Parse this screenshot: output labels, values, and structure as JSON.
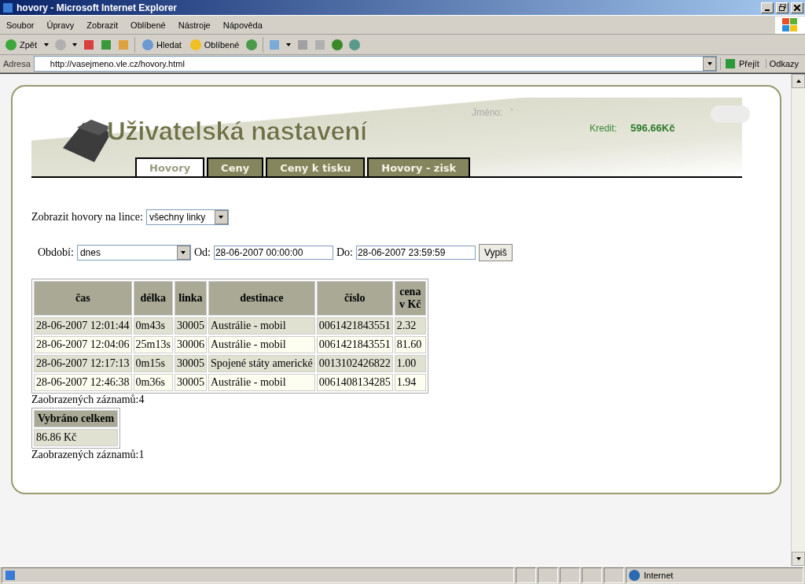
{
  "window": {
    "title": "hovory - Microsoft Internet Explorer"
  },
  "menu": [
    "Soubor",
    "Úpravy",
    "Zobrazit",
    "Oblíbené",
    "Nástroje",
    "Nápověda"
  ],
  "toolbar": {
    "back": "Zpět",
    "search": "Hledat",
    "favorites": "Oblíbené"
  },
  "address": {
    "label": "Adresa",
    "value": "http://vasejmeno.vle.cz/hovory.html",
    "go": "Přejít",
    "links": "Odkazy"
  },
  "header": {
    "title": "Uživatelská nastavení",
    "name_label": "Jméno:",
    "name_value": "'",
    "credit_label": "Kredit:",
    "credit_value": "596.66Kč"
  },
  "tabs": [
    {
      "label": "Hovory",
      "selected": true
    },
    {
      "label": "Ceny",
      "selected": false
    },
    {
      "label": "Ceny k tisku",
      "selected": false
    },
    {
      "label": "Hovory - zisk",
      "selected": false
    }
  ],
  "line_filter": {
    "label": "Zobrazit hovory na lince:",
    "value": "všechny linky"
  },
  "period": {
    "label": "Období:",
    "value": "dnes",
    "from_label": "Od:",
    "from_value": "28-06-2007 00:00:00",
    "to_label": "Do:",
    "to_value": "28-06-2007 23:59:59",
    "button": "Vypiš"
  },
  "calls_table": {
    "columns": [
      "čas",
      "délka",
      "linka",
      "destinace",
      "číslo",
      "cena v Kč"
    ],
    "rows": [
      [
        "28-06-2007 12:01:44",
        "0m43s",
        "30005",
        "Austrálie - mobil",
        "0061421843551",
        "2.32"
      ],
      [
        "28-06-2007 12:04:06",
        "25m13s",
        "30006",
        "Austrálie - mobil",
        "0061421843551",
        "81.60"
      ],
      [
        "28-06-2007 12:17:13",
        "0m15s",
        "30005",
        "Spojené státy americké",
        "0013102426822",
        "1.00"
      ],
      [
        "28-06-2007 12:46:38",
        "0m36s",
        "30005",
        "Austrálie - mobil",
        "0061408134285",
        "1.94"
      ]
    ]
  },
  "calls_count": "Zaobrazených záznamů:4",
  "total_table": {
    "columns": [
      "Vybráno celkem"
    ],
    "rows": [
      [
        "86.86 Kč"
      ]
    ]
  },
  "total_count": "Zaobrazených záznamů:1",
  "status_bar": {
    "zone": "Internet"
  }
}
